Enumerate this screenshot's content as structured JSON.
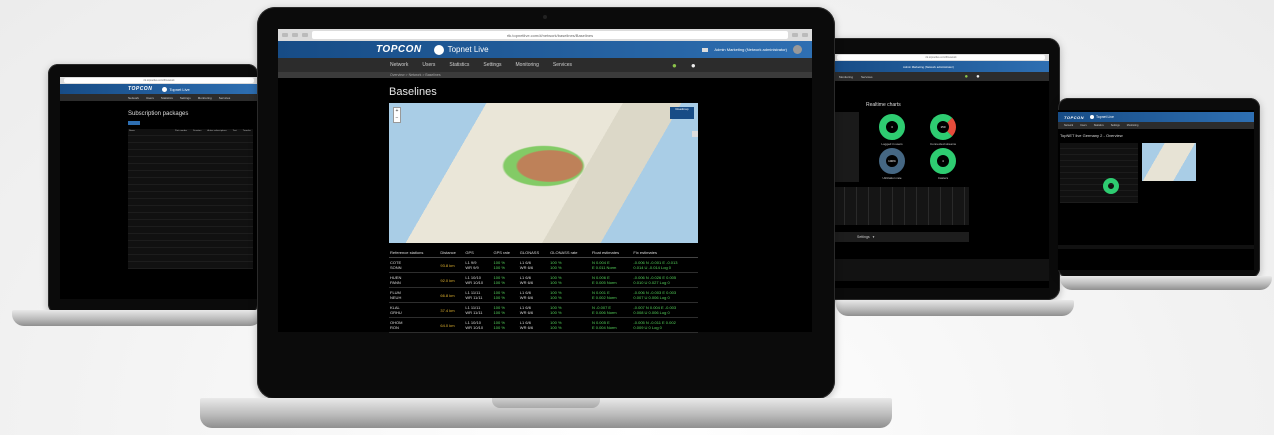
{
  "browser": {
    "url_center": "rtk.topnetlive.com/#/network/baselines/Baselines",
    "url_small": "rtk.topnetlive.com/#/network"
  },
  "brand": {
    "company": "TOPCON",
    "product": "Topnet Live",
    "user": "Admin Marketing (Network administrator)"
  },
  "nav": [
    "Network",
    "Users",
    "Statistics",
    "Settings",
    "Monitoring",
    "Services"
  ],
  "breadcrumb": "Overview > Network > Baselines",
  "baselines": {
    "title": "Baselines",
    "map_layer": "Roadmap",
    "headers": [
      "Reference stations",
      "Distance",
      "GPS",
      "GPS rate",
      "GLONASS",
      "GLONASS rate",
      "Float estimates",
      "Fix estimates"
    ],
    "rows": [
      {
        "st": "COTE\nSONN",
        "dist": "93.8 km",
        "gps": "L1 9/9\nWR 9/9",
        "gr": "100 %\n100 %",
        "glo": "L1 6/6\nWR 6/6",
        "glr": "100 %\n100 %",
        "flt": "N 0.004 E\nE 0.011 Norm",
        "fix": "-0.006 N -0.001 E -0.013\n0.014 U -0.014 Log 0"
      },
      {
        "st": "HUEN\nPANN",
        "dist": "92.0 km",
        "gps": "L1 10/10\nWR 10/10",
        "gr": "100 %\n100 %",
        "glo": "L1 6/6\nWR 6/6",
        "glr": "100 %\n100 %",
        "flt": "N 0.006 E\nE 0.005 Norm",
        "fix": "-0.006 N -0.026 E 0.005\n0.010 U 0.027 Log 0"
      },
      {
        "st": "FLUM\nNEUH",
        "dist": "66.8 km",
        "gps": "L1 11/11\nWR 11/11",
        "gr": "100 %\n100 %",
        "glo": "L1 6/6\nWR 6/6",
        "glr": "100 %\n100 %",
        "flt": "N 0.001 E\nE 0.002 Norm",
        "fix": "-0.006 N -0.003 E 0.003\n0.007 U 0.006 Log 0"
      },
      {
        "st": "KLAL\nGRHU",
        "dist": "37.4 km",
        "gps": "L1 11/11\nWR 11/11",
        "gr": "100 %\n100 %",
        "glo": "L1 6/6\nWR 6/6",
        "glr": "100 %\n100 %",
        "flt": "N -0.007 E\nE 0.006 Norm",
        "fix": "-0.007 N 0.004 E -0.003\n0.008 U 0.006 Log 0"
      },
      {
        "st": "OHOM\nRON",
        "dist": "64.0 km",
        "gps": "L1 10/10\nWR 10/10",
        "gr": "100 %\n100 %",
        "glo": "L1 6/6\nWR 6/6",
        "glr": "100 %\n100 %",
        "flt": "N 0.005 E\nE 0.004 Norm",
        "fix": "-0.005 N -0.011 E 0.002\n0.009 U 0 Log 0"
      }
    ]
  },
  "subscriptions": {
    "title": "Subscription packages",
    "headers": [
      "Name",
      "Part number",
      "Duration",
      "Active subscriptions",
      "Test",
      "Transfer"
    ]
  },
  "realtime": {
    "title": "Realtime charts",
    "donuts": [
      {
        "value": "3",
        "label": "Logged in users"
      },
      {
        "value": "150",
        "label": "Connected streams"
      },
      {
        "value": "100%",
        "label": "Utilization rate"
      },
      {
        "value": "4",
        "label": "Casters"
      }
    ],
    "settings": "Settings"
  },
  "overview": {
    "title": "TopNET live Germany 2 - Overview"
  }
}
